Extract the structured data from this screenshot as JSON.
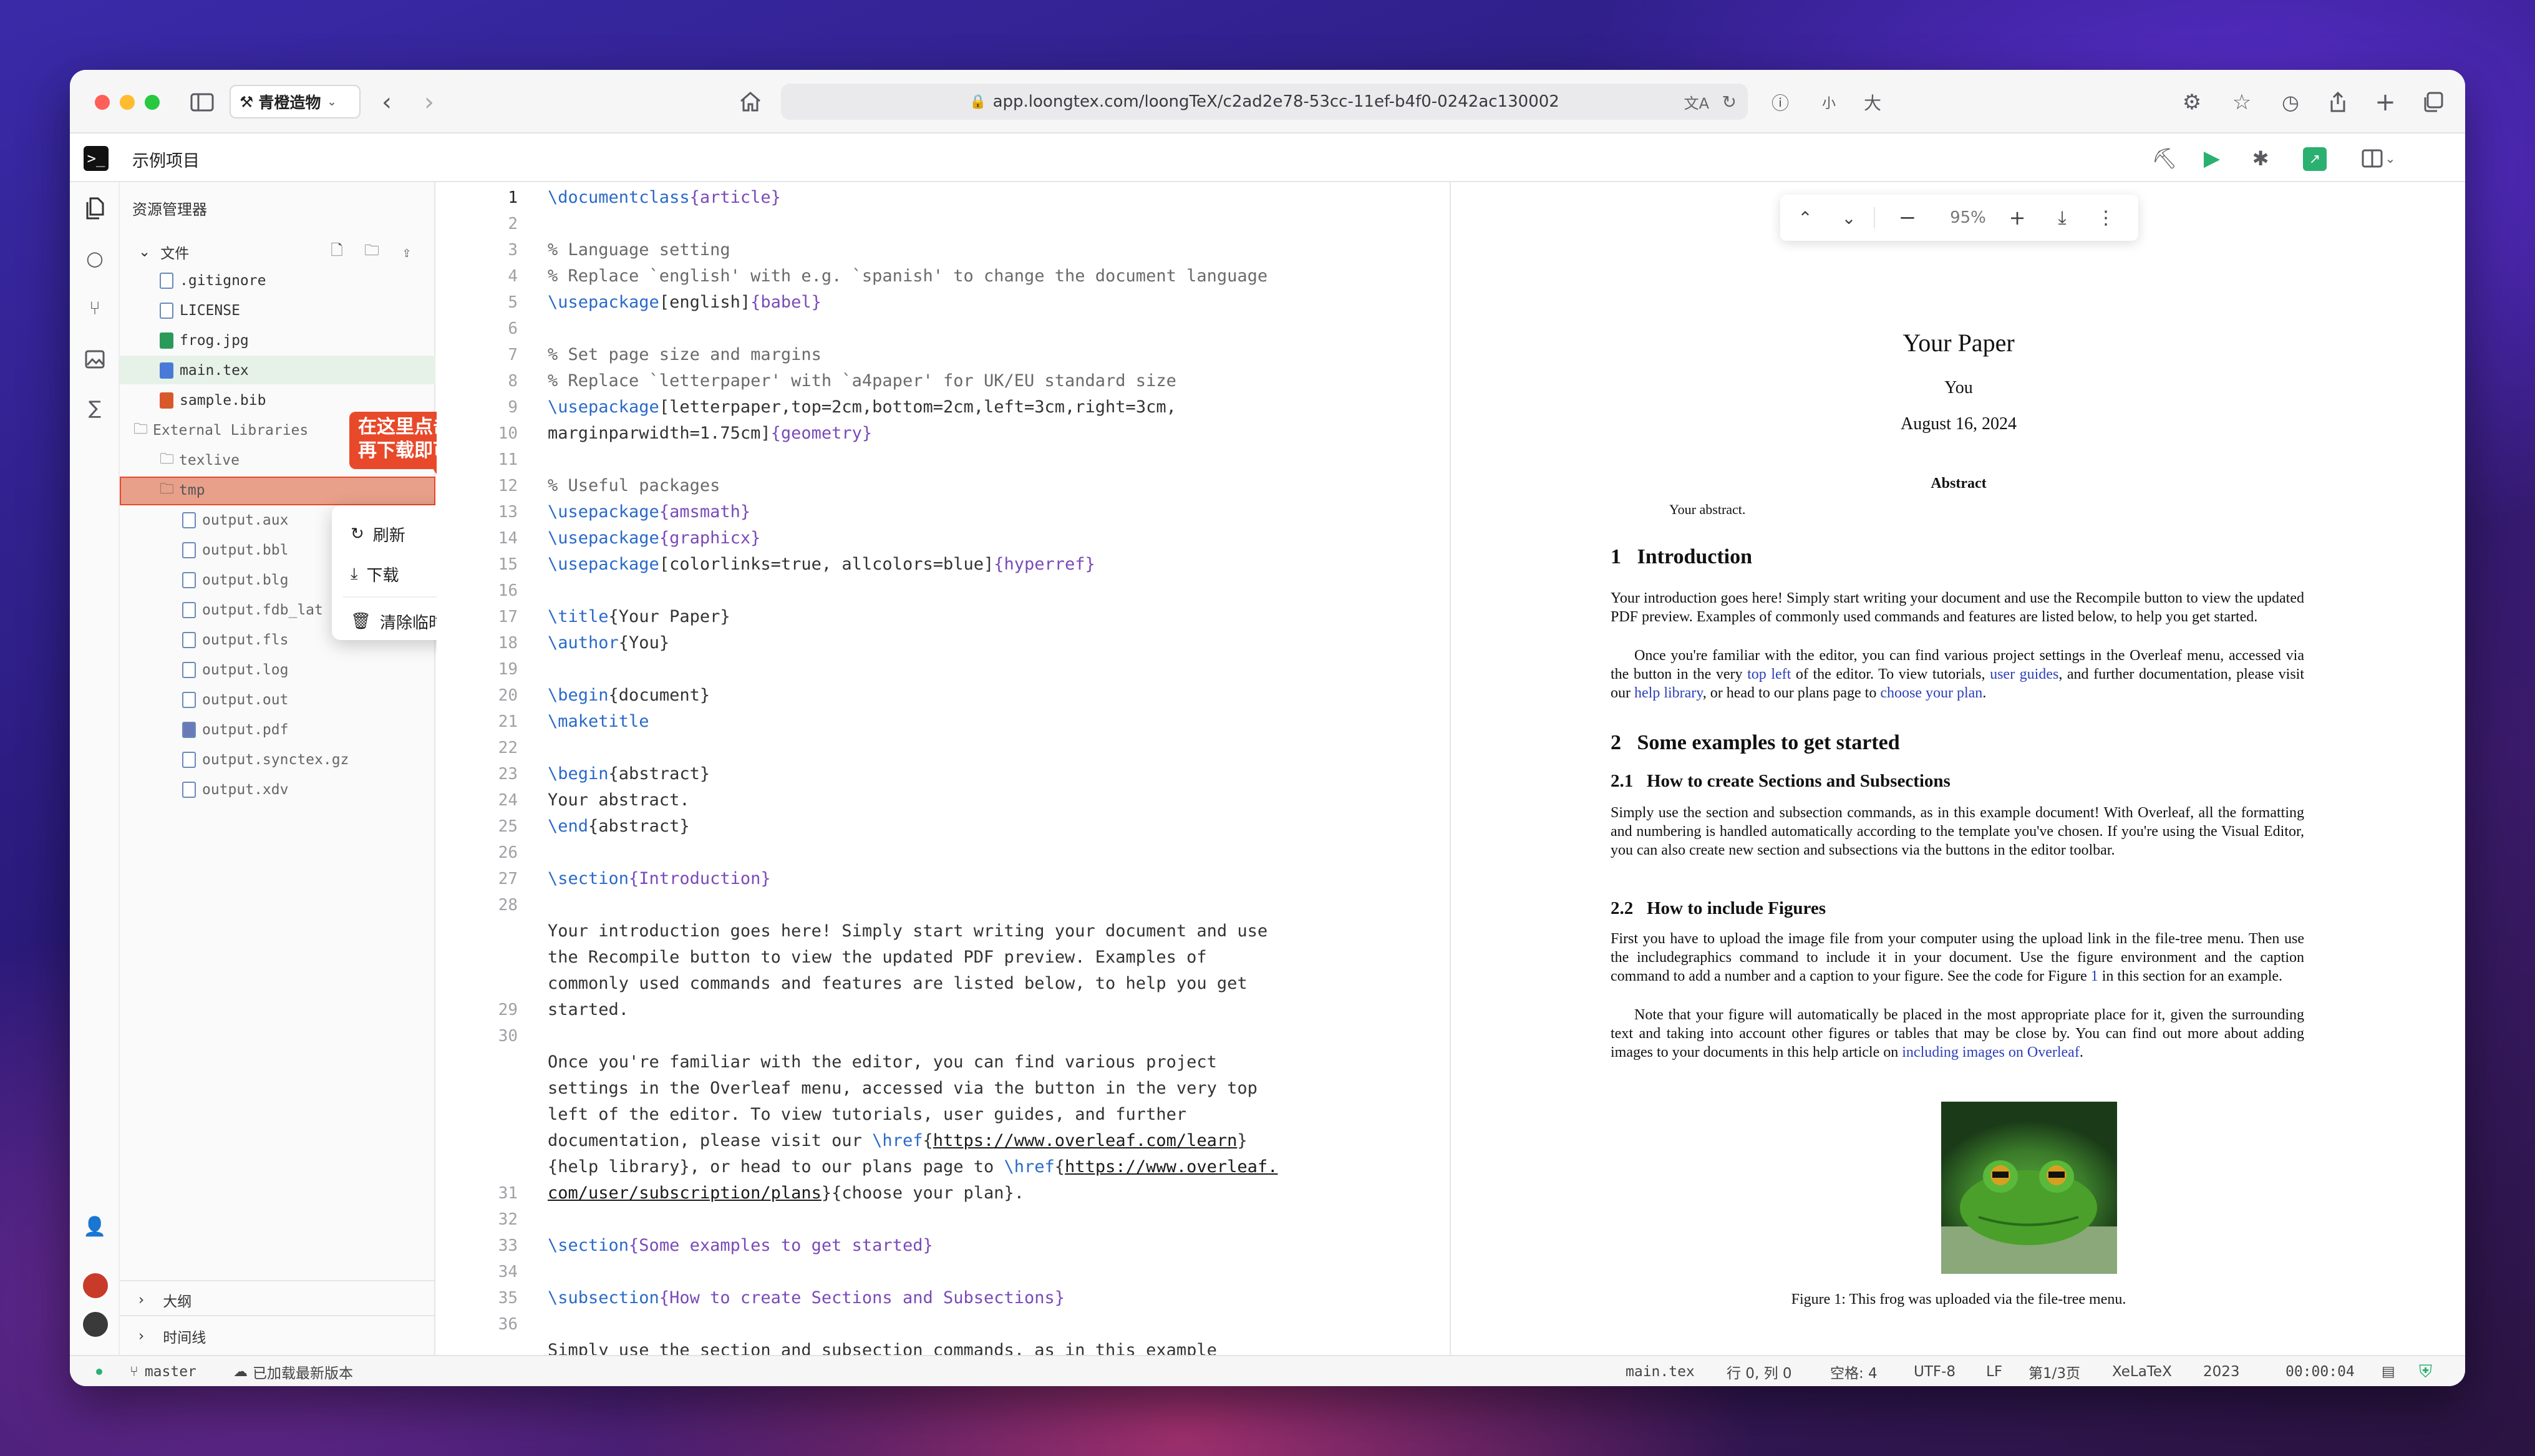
{
  "browser": {
    "tab_title": "青橙造物",
    "url": "app.loongtex.com/loongTeX/c2ad2e78-53cc-11ef-b4f0-0242ac130002",
    "font_small": "小",
    "font_large": "大"
  },
  "app": {
    "project": "示例项目",
    "explorer_title": "资源管理器",
    "files_label": "文件"
  },
  "tree": {
    "files": [
      ".gitignore",
      "LICENSE",
      "frog.jpg",
      "main.tex",
      "sample.bib"
    ],
    "external": "External Libraries",
    "texlive": "texlive",
    "tmp": "tmp",
    "tmp_files": [
      "output.aux",
      "output.bbl",
      "output.blg",
      "output.fdb_lat",
      "output.fls",
      "output.log",
      "output.out",
      "output.pdf",
      "output.synctex.gz",
      "output.xdv"
    ],
    "outline": "大纲",
    "timeline": "时间线"
  },
  "callout": {
    "line1": "在这里点击鼠标右键,",
    "line2": "再下载即可"
  },
  "context_menu": {
    "refresh": "刷新",
    "download": "下载",
    "clear": "清除临时文件"
  },
  "editor": {
    "line_numbers": [
      "1",
      "2",
      "3",
      "4",
      "5",
      "6",
      "7",
      "8",
      "9",
      "10",
      "11",
      "12",
      "13",
      "14",
      "15",
      "16",
      "17",
      "18",
      "19",
      "20",
      "21",
      "22",
      "23",
      "24",
      "25",
      "26",
      "27",
      "28",
      "",
      "",
      "",
      "29",
      "30",
      "",
      "",
      "",
      "",
      "",
      "31",
      "32",
      "33",
      "34",
      "35",
      "36"
    ]
  },
  "code": {
    "l1a": "\\documentclass",
    "l1b": "{article}",
    "l3": "% Language setting",
    "l4": "% Replace `english' with e.g. `spanish' to change the document language",
    "l5a": "\\usepackage",
    "l5b": "[english]",
    "l5c": "{babel}",
    "l7": "% Set page size and margins",
    "l8": "% Replace `letterpaper' with `a4paper' for UK/EU standard size",
    "l9a": "\\usepackage",
    "l9b": "[letterpaper,top=2cm,bottom=2cm,left=3cm,right=3cm,",
    "l9c": "marginparwidth=1.75cm]",
    "l9d": "{geometry}",
    "l11": "% Useful packages",
    "l12a": "\\usepackage",
    "l12b": "{amsmath}",
    "l13a": "\\usepackage",
    "l13b": "{graphicx}",
    "l14a": "\\usepackage",
    "l14b": "[colorlinks=true, allcolors=blue]",
    "l14c": "{hyperref}",
    "l16a": "\\title",
    "l16b": "{Your Paper}",
    "l17a": "\\author",
    "l17b": "{You}",
    "l19a": "\\begin",
    "l19b": "{document}",
    "l20": "\\maketitle",
    "l22a": "\\begin",
    "l22b": "{abstract}",
    "l23": "Your abstract.",
    "l24a": "\\end",
    "l24b": "{abstract}",
    "l26a": "\\section",
    "l26b": "{Introduction}",
    "l28a": "Your introduction goes here! Simply start writing your document and use",
    "l28b": "the Recompile button to view the updated PDF preview. Examples of",
    "l28c": "commonly used commands and features are listed below, to help you get",
    "l28d": "started.",
    "l30a": "Once you're familiar with the editor, you can find various project",
    "l30b": "settings in the Overleaf menu, accessed via the button in the very top",
    "l30c": "left of the editor. To view tutorials, user guides, and further",
    "l30d1": "documentation, please visit our ",
    "l30d2": "\\href",
    "l30d3": "{",
    "l30d4": "https://www.overleaf.com/learn",
    "l30d5": "}",
    "l30e1": "{help library}, or head to our plans page to ",
    "l30e2": "\\href",
    "l30e3": "{",
    "l30e4": "https://www.overleaf.",
    "l30f1": "com/user/subscription/plans",
    "l30f2": "}",
    "l30f3": "{choose your plan}.",
    "l32a": "\\section",
    "l32b": "{Some examples to get started}",
    "l34a": "\\subsection",
    "l34b": "{How to create Sections and Subsections}",
    "l36": "Simply use the section and subsection commands, as in this example"
  },
  "pdf_toolbar": {
    "zoom": "95%"
  },
  "pdf": {
    "title": "Your Paper",
    "author": "You",
    "date": "August 16, 2024",
    "abstract_h": "Abstract",
    "abstract": "Your abstract.",
    "s1": "1   Introduction",
    "p1": "Your introduction goes here! Simply start writing your document and use the Recompile button to view the updated PDF preview. Examples of commonly used commands and features are listed below, to help you get started.",
    "p2a": "Once you're familiar with the editor, you can find various project settings in the Overleaf menu, accessed via the button in the very ",
    "p2b": "top left",
    "p2c": " of the editor. To view tutorials, ",
    "p2d": "user guides",
    "p2e": ", and further documentation, please visit our ",
    "p2f": "help library",
    "p2g": ", or head to our plans page to ",
    "p2h": "choose your plan",
    "p2i": ".",
    "s2": "2   Some examples to get started",
    "s21": "2.1   How to create Sections and Subsections",
    "p3": "Simply use the section and subsection commands, as in this example document! With Overleaf, all the formatting and numbering is handled automatically according to the template you've chosen. If you're using the Visual Editor, you can also create new section and subsections via the buttons in the editor toolbar.",
    "s22": "2.2   How to include Figures",
    "p4a": "First you have to upload the image file from your computer using the upload link in the file-tree menu. Then use the includegraphics command to include it in your document. Use the figure environment and the caption command to add a number and a caption to your figure. See the code for Figure ",
    "p4b": "1",
    "p4c": " in this section for an example.",
    "p5a": "Note that your figure will automatically be placed in the most appropriate place for it, given the surrounding text and taking into account other figures or tables that may be close by. You can find out more about adding images to your documents in this help article on ",
    "p5b": "including images on Overleaf",
    "p5c": ".",
    "caption": "Figure 1: This frog was uploaded via the file-tree menu."
  },
  "status": {
    "branch": "master",
    "sync": "已加载最新版本",
    "file": "main.tex",
    "pos": "行 0, 列 0",
    "spaces": "空格: 4",
    "encoding": "UTF-8",
    "eol": "LF",
    "page": "第1/3页",
    "engine": "XeLaTeX",
    "year": "2023",
    "time": "00:00:04"
  },
  "colors": {
    "accent": "#2a6ac8",
    "link": "#2b3fb8",
    "callout": "#e8492a",
    "run": "#2ab070"
  }
}
